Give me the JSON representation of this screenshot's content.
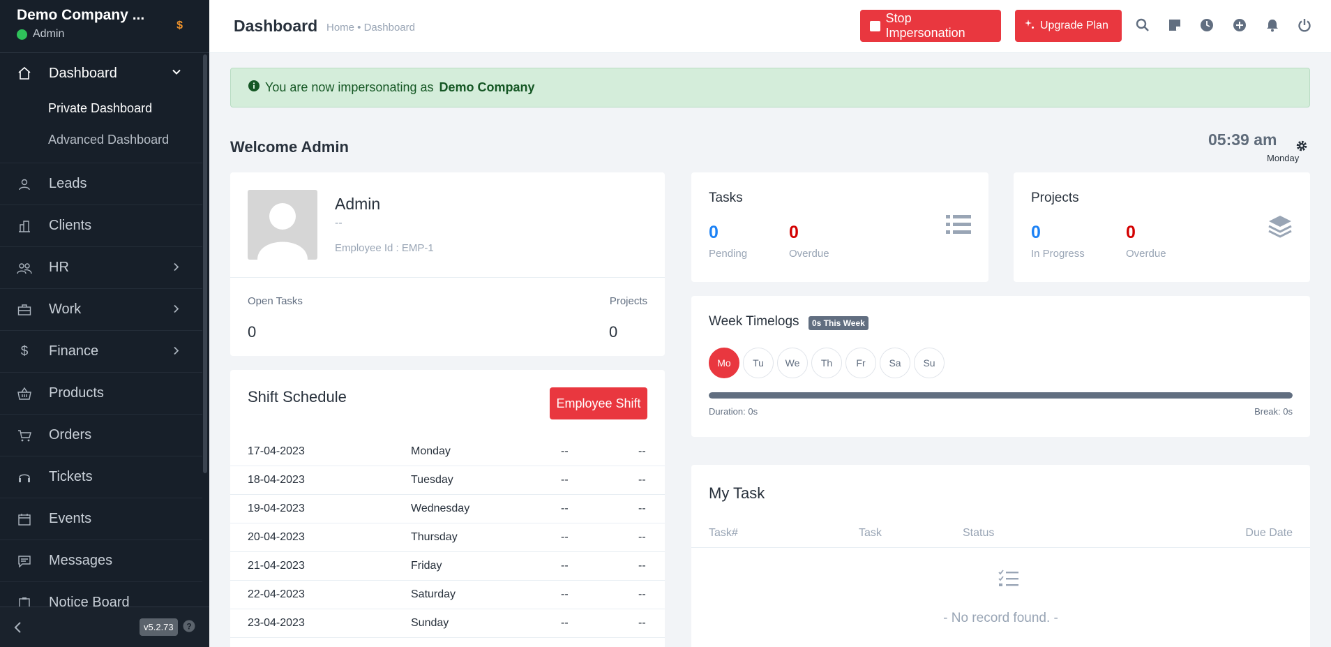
{
  "sidebar": {
    "company": "Demo Company ...",
    "role": "Admin",
    "coin": "$",
    "menu": {
      "dashboard": "Dashboard",
      "private_dashboard": "Private Dashboard",
      "advanced_dashboard": "Advanced Dashboard",
      "leads": "Leads",
      "clients": "Clients",
      "hr": "HR",
      "work": "Work",
      "finance": "Finance",
      "products": "Products",
      "orders": "Orders",
      "tickets": "Tickets",
      "events": "Events",
      "messages": "Messages",
      "notice_board": "Notice Board"
    },
    "version": "v5.2.73",
    "help": "?"
  },
  "header": {
    "title": "Dashboard",
    "breadcrumb": "Home • Dashboard",
    "stop_impersonation": "Stop Impersonation",
    "upgrade_plan": "Upgrade Plan"
  },
  "alert": {
    "prefix": "You are now impersonating as",
    "company": "Demo Company"
  },
  "welcome": "Welcome Admin",
  "clock": {
    "time": "05:39 am",
    "day": "Monday"
  },
  "profile": {
    "name": "Admin",
    "designation": "--",
    "employee_id": "Employee Id : EMP-1",
    "open_tasks_label": "Open Tasks",
    "open_tasks": "0",
    "projects_label": "Projects",
    "projects": "0"
  },
  "shift": {
    "title": "Shift Schedule",
    "button": "Employee Shift",
    "rows": [
      {
        "date": "17-04-2023",
        "day": "Monday",
        "a": "--",
        "b": "--"
      },
      {
        "date": "18-04-2023",
        "day": "Tuesday",
        "a": "--",
        "b": "--"
      },
      {
        "date": "19-04-2023",
        "day": "Wednesday",
        "a": "--",
        "b": "--"
      },
      {
        "date": "20-04-2023",
        "day": "Thursday",
        "a": "--",
        "b": "--"
      },
      {
        "date": "21-04-2023",
        "day": "Friday",
        "a": "--",
        "b": "--"
      },
      {
        "date": "22-04-2023",
        "day": "Saturday",
        "a": "--",
        "b": "--"
      },
      {
        "date": "23-04-2023",
        "day": "Sunday",
        "a": "--",
        "b": "--"
      }
    ]
  },
  "tasks_widget": {
    "title": "Tasks",
    "pending": "0",
    "pending_label": "Pending",
    "overdue": "0",
    "overdue_label": "Overdue"
  },
  "projects_widget": {
    "title": "Projects",
    "in_progress": "0",
    "in_progress_label": "In Progress",
    "overdue": "0",
    "overdue_label": "Overdue"
  },
  "timelogs": {
    "title": "Week Timelogs",
    "badge": "0s This Week",
    "days": [
      "Mo",
      "Tu",
      "We",
      "Th",
      "Fr",
      "Sa",
      "Su"
    ],
    "active_day": 0,
    "duration": "Duration: 0s",
    "break": "Break: 0s",
    "progress": 1.0
  },
  "my_task": {
    "title": "My Task",
    "columns": [
      "Task#",
      "Task",
      "Status",
      "Due Date"
    ],
    "empty": "- No record found. -"
  },
  "colors": {
    "sidebar_bg": "#171f29",
    "accent_red": "#e9373f",
    "blue": "#1d82f5",
    "overdue_red": "#d30000",
    "alert_bg": "#d4edda"
  }
}
